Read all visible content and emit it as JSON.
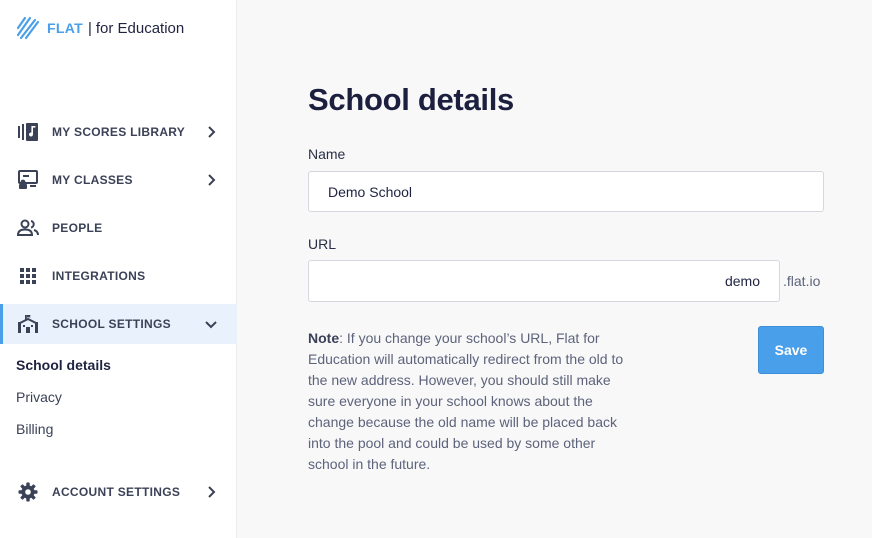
{
  "brand": {
    "name": "FLAT",
    "separator": "|",
    "product": "for Education",
    "accent_color": "#4a9fea"
  },
  "sidebar": {
    "items": [
      {
        "label": "MY SCORES LIBRARY",
        "icon": "music-library-icon",
        "has_chevron": true
      },
      {
        "label": "MY CLASSES",
        "icon": "classroom-icon",
        "has_chevron": true
      },
      {
        "label": "PEOPLE",
        "icon": "people-icon",
        "has_chevron": false
      },
      {
        "label": "INTEGRATIONS",
        "icon": "grid-icon",
        "has_chevron": false
      },
      {
        "label": "SCHOOL SETTINGS",
        "icon": "school-icon",
        "has_chevron": true,
        "expanded": true,
        "active": true
      },
      {
        "label": "ACCOUNT SETTINGS",
        "icon": "gear-icon",
        "has_chevron": true
      }
    ],
    "sub_items": [
      {
        "label": "School details",
        "current": true
      },
      {
        "label": "Privacy",
        "current": false
      },
      {
        "label": "Billing",
        "current": false
      }
    ]
  },
  "main": {
    "title": "School details",
    "name_label": "Name",
    "name_value": "Demo School",
    "url_label": "URL",
    "url_value": "demo",
    "url_suffix": ".flat.io",
    "note_title": "Note",
    "note_text": ": If you change your school’s URL, Flat for Education will automatically redirect from the old to the new address. However, you should still make sure everyone in your school knows about the change because the old name will be placed back into the pool and could be used by some other school in the future.",
    "save_label": "Save"
  }
}
